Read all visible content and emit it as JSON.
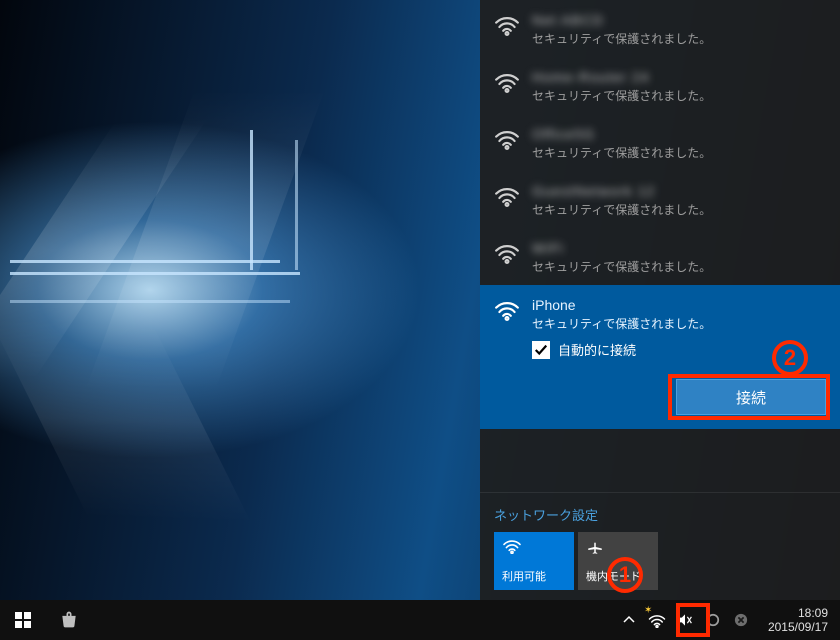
{
  "desktop": {
    "os": "Windows 10"
  },
  "flyout": {
    "networks": [
      {
        "ssid_hidden": true,
        "sub": "セキュリティで保護されました。"
      },
      {
        "ssid_hidden": true,
        "sub": "セキュリティで保護されました。"
      },
      {
        "ssid_hidden": true,
        "sub": "セキュリティで保護されました。"
      },
      {
        "ssid_hidden": true,
        "sub": "セキュリティで保護されました。"
      },
      {
        "ssid_hidden": true,
        "sub": "セキュリティで保護されました。"
      }
    ],
    "selected": {
      "ssid": "iPhone",
      "sub": "セキュリティで保護されました。",
      "auto_label": "自動的に接続",
      "auto_checked": true,
      "connect_label": "接続"
    },
    "settings_title": "ネットワーク設定",
    "tiles": {
      "wifi_label": "利用可能",
      "airplane_label": "機内モード"
    }
  },
  "taskbar": {
    "time": "18:09",
    "date": "2015/09/17"
  },
  "annotations": {
    "one": "1",
    "two": "2"
  }
}
